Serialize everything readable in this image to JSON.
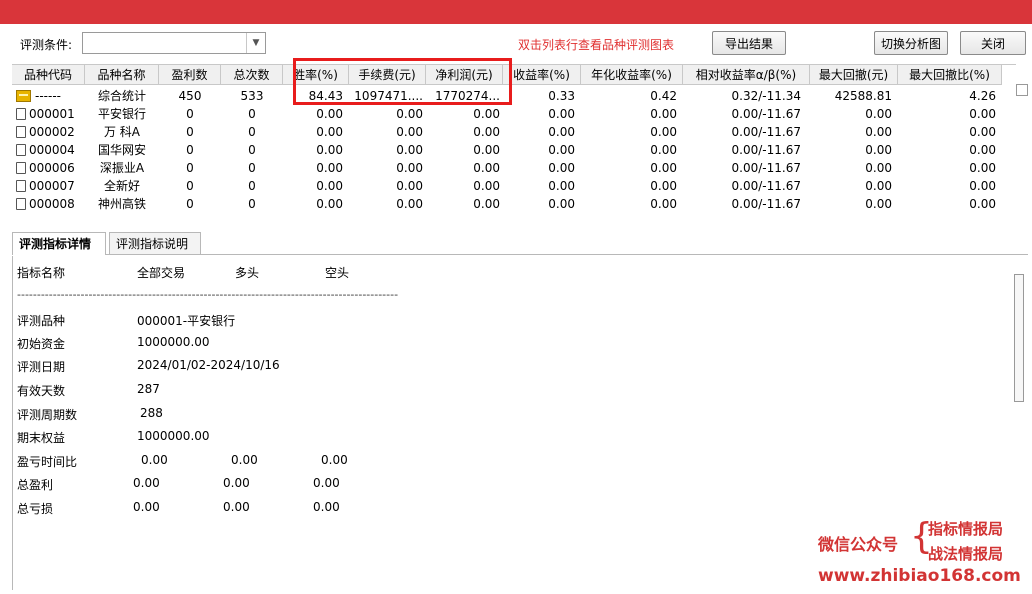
{
  "toolbar": {
    "condition_label": "评测条件:",
    "condition_value": "",
    "hint": "双击列表行查看品种评测图表",
    "export_label": "导出结果",
    "switch_label": "切换分析图",
    "close_label": "关闭"
  },
  "table": {
    "headers": [
      "品种代码",
      "品种名称",
      "盈利数",
      "总次数",
      "胜率(%)",
      "手续费(元)",
      "净利润(元)",
      "收益率(%)",
      "年化收益率(%)",
      "相对收益率α/β(%)",
      "最大回撤(元)",
      "最大回撤比(%)"
    ],
    "rows": [
      {
        "code": "------",
        "name": "综合统计",
        "win": "450",
        "total": "533",
        "rate": "84.43",
        "fee": "1097471....",
        "profit": "1770274...",
        "ret": "0.33",
        "annual": "0.42",
        "rel": "0.32/-11.34",
        "mdd": "42588.81",
        "mddr": "4.26"
      },
      {
        "code": "000001",
        "name": "平安银行",
        "win": "0",
        "total": "0",
        "rate": "0.00",
        "fee": "0.00",
        "profit": "0.00",
        "ret": "0.00",
        "annual": "0.00",
        "rel": "0.00/-11.67",
        "mdd": "0.00",
        "mddr": "0.00"
      },
      {
        "code": "000002",
        "name": "万 科A",
        "win": "0",
        "total": "0",
        "rate": "0.00",
        "fee": "0.00",
        "profit": "0.00",
        "ret": "0.00",
        "annual": "0.00",
        "rel": "0.00/-11.67",
        "mdd": "0.00",
        "mddr": "0.00"
      },
      {
        "code": "000004",
        "name": "国华网安",
        "win": "0",
        "total": "0",
        "rate": "0.00",
        "fee": "0.00",
        "profit": "0.00",
        "ret": "0.00",
        "annual": "0.00",
        "rel": "0.00/-11.67",
        "mdd": "0.00",
        "mddr": "0.00"
      },
      {
        "code": "000006",
        "name": "深振业A",
        "win": "0",
        "total": "0",
        "rate": "0.00",
        "fee": "0.00",
        "profit": "0.00",
        "ret": "0.00",
        "annual": "0.00",
        "rel": "0.00/-11.67",
        "mdd": "0.00",
        "mddr": "0.00"
      },
      {
        "code": "000007",
        "name": "全新好",
        "win": "0",
        "total": "0",
        "rate": "0.00",
        "fee": "0.00",
        "profit": "0.00",
        "ret": "0.00",
        "annual": "0.00",
        "rel": "0.00/-11.67",
        "mdd": "0.00",
        "mddr": "0.00"
      },
      {
        "code": "000008",
        "name": "神州高铁",
        "win": "0",
        "total": "0",
        "rate": "0.00",
        "fee": "0.00",
        "profit": "0.00",
        "ret": "0.00",
        "annual": "0.00",
        "rel": "0.00/-11.67",
        "mdd": "0.00",
        "mddr": "0.00"
      }
    ]
  },
  "tabs": [
    {
      "label": "评测指标详情"
    },
    {
      "label": "评测指标说明"
    }
  ],
  "detail": {
    "col_headers": [
      "指标名称",
      "全部交易",
      "多头",
      "空头"
    ],
    "separator": "------------------------------------------------------------------------------------------------",
    "items": [
      {
        "label": "评测品种",
        "value": "000001-平安银行"
      },
      {
        "label": "初始资金",
        "value": "1000000.00"
      },
      {
        "label": "评测日期",
        "value": "2024/01/02-2024/10/16"
      },
      {
        "label": "有效天数",
        "value": "287"
      },
      {
        "label": "评测周期数",
        "value": "288"
      },
      {
        "label": "期末权益",
        "value": "1000000.00"
      }
    ],
    "triples": [
      {
        "label": "盈亏时间比",
        "values": [
          "0.00",
          "0.00",
          "0.00"
        ]
      },
      {
        "label": "总盈利",
        "values": [
          "0.00",
          "0.00",
          "0.00"
        ]
      },
      {
        "label": "总亏损",
        "values": [
          "0.00",
          "0.00",
          "0.00"
        ]
      }
    ]
  },
  "watermark": {
    "line1": "微信公众号",
    "brace": "{",
    "line2": "指标情报局",
    "line3": "战法情报局",
    "url": "www.zhibiao168.com"
  },
  "colors": {
    "titlebar": "#d9353a",
    "hint": "#e03030",
    "highlight": "#e81c1c",
    "watermark": "#d23434"
  }
}
